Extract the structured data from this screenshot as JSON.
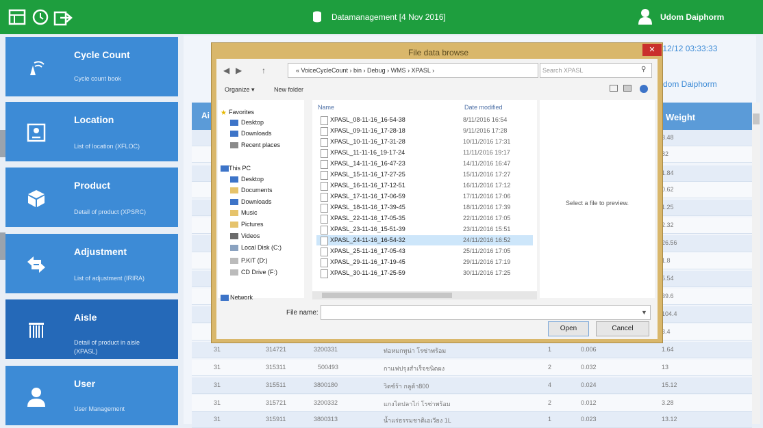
{
  "topbar": {
    "title": "Datamanagement [4 Nov 2016]",
    "user": "Udom Daiphorm",
    "icons": [
      "table-icon",
      "history-icon",
      "export-icon",
      "database-icon",
      "user-icon"
    ]
  },
  "sidebar": {
    "items": [
      {
        "title": "Cycle Count",
        "subtitle": "Cycle count book",
        "icon": "cycle-count-icon"
      },
      {
        "title": "Location",
        "subtitle": "List of location (XFLOC)",
        "icon": "location-icon"
      },
      {
        "title": "Product",
        "subtitle": "Detail of product (XPSRC)",
        "icon": "box-icon"
      },
      {
        "title": "Adjustment",
        "subtitle": "List of adjustment (IRIRA)",
        "icon": "swap-arrows-icon"
      },
      {
        "title": "Aisle",
        "subtitle_line1": "Detail of product in aisle",
        "subtitle_line2": "(XPASL)",
        "icon": "barcode-icon"
      },
      {
        "title": "User",
        "subtitle": "User Management",
        "icon": "user-icon"
      }
    ]
  },
  "main": {
    "datetime": "/12/12 03:33:33",
    "user": "dom Daiphorm",
    "grid": {
      "header_first": "Ai",
      "header_weight": "Weight",
      "weights_top": [
        "3.48",
        "82",
        "1.84",
        "0.62",
        "1.25",
        "2.32",
        "26.56",
        "1.8",
        "5.54",
        "39.6",
        "104.4",
        "3.4"
      ],
      "rows_bottom": [
        {
          "aisle": "31",
          "loc": "314721",
          "sku": "3200331",
          "desc": "ท่อหมกทูน่า โรซ่าพร้อม",
          "qty": "1",
          "vol": "0.006",
          "weight": "1.64"
        },
        {
          "aisle": "31",
          "loc": "315311",
          "sku": "500493",
          "desc": "กาแฟปรุงสำเร็จชนิดผง",
          "qty": "2",
          "vol": "0.032",
          "weight": "13"
        },
        {
          "aisle": "31",
          "loc": "315511",
          "sku": "3800180",
          "desc": "วิตซ์ร้า กลูต้า800",
          "qty": "4",
          "vol": "0.024",
          "weight": "15.12"
        },
        {
          "aisle": "31",
          "loc": "315721",
          "sku": "3200332",
          "desc": "แกงไตปลาไก่ โรซ่าพร้อม",
          "qty": "2",
          "vol": "0.012",
          "weight": "3.28"
        },
        {
          "aisle": "31",
          "loc": "315911",
          "sku": "3800313",
          "desc": "น้ำแร่ธรรมชาติเอเวียง 1L",
          "qty": "1",
          "vol": "0.023",
          "weight": "13.12"
        }
      ]
    }
  },
  "dialog": {
    "title": "File data browse",
    "close": "✕",
    "path": "« VoiceCycleCount › bin › Debug › WMS › XPASL ›",
    "search_placeholder": "Search XPASL",
    "organize": "Organize ▾",
    "new_folder": "New folder",
    "nav": {
      "favorites": "Favorites",
      "desktop": "Desktop",
      "downloads": "Downloads",
      "recent": "Recent places",
      "thispc": "This PC",
      "pc_desktop": "Desktop",
      "documents": "Documents",
      "pc_downloads": "Downloads",
      "music": "Music",
      "pictures": "Pictures",
      "videos": "Videos",
      "local_disk": "Local Disk (C:)",
      "pkit": "P.KIT (D:)",
      "cd": "CD Drive (F:)",
      "network": "Network"
    },
    "col_name": "Name",
    "col_date": "Date modified",
    "files": [
      {
        "name": "XPASL_08-11-16_16-54-38",
        "date": "8/11/2016 16:54"
      },
      {
        "name": "XPASL_09-11-16_17-28-18",
        "date": "9/11/2016 17:28"
      },
      {
        "name": "XPASL_10-11-16_17-31-28",
        "date": "10/11/2016 17:31"
      },
      {
        "name": "XPASL_11-11-16_19-17-24",
        "date": "11/11/2016 19:17"
      },
      {
        "name": "XPASL_14-11-16_16-47-23",
        "date": "14/11/2016 16:47"
      },
      {
        "name": "XPASL_15-11-16_17-27-25",
        "date": "15/11/2016 17:27"
      },
      {
        "name": "XPASL_16-11-16_17-12-51",
        "date": "16/11/2016 17:12"
      },
      {
        "name": "XPASL_17-11-16_17-06-59",
        "date": "17/11/2016 17:06"
      },
      {
        "name": "XPASL_18-11-16_17-39-45",
        "date": "18/11/2016 17:39"
      },
      {
        "name": "XPASL_22-11-16_17-05-35",
        "date": "22/11/2016 17:05"
      },
      {
        "name": "XPASL_23-11-16_15-51-39",
        "date": "23/11/2016 15:51"
      },
      {
        "name": "XPASL_24-11-16_16-54-32",
        "date": "24/11/2016 16:52"
      },
      {
        "name": "XPASL_25-11-16_17-05-43",
        "date": "25/11/2016 17:05"
      },
      {
        "name": "XPASL_29-11-16_17-19-45",
        "date": "29/11/2016 17:19"
      },
      {
        "name": "XPASL_30-11-16_17-25-59",
        "date": "30/11/2016 17:25"
      }
    ],
    "preview": "Select a file to preview.",
    "file_name_label": "File name:",
    "file_name_value": "",
    "open": "Open",
    "cancel": "Cancel"
  },
  "colors": {
    "topbar": "#1e9e3e",
    "sidebar": "#3d8bd6",
    "sidebar_active": "#2569b8",
    "dialog_frame": "#d9b76b"
  }
}
